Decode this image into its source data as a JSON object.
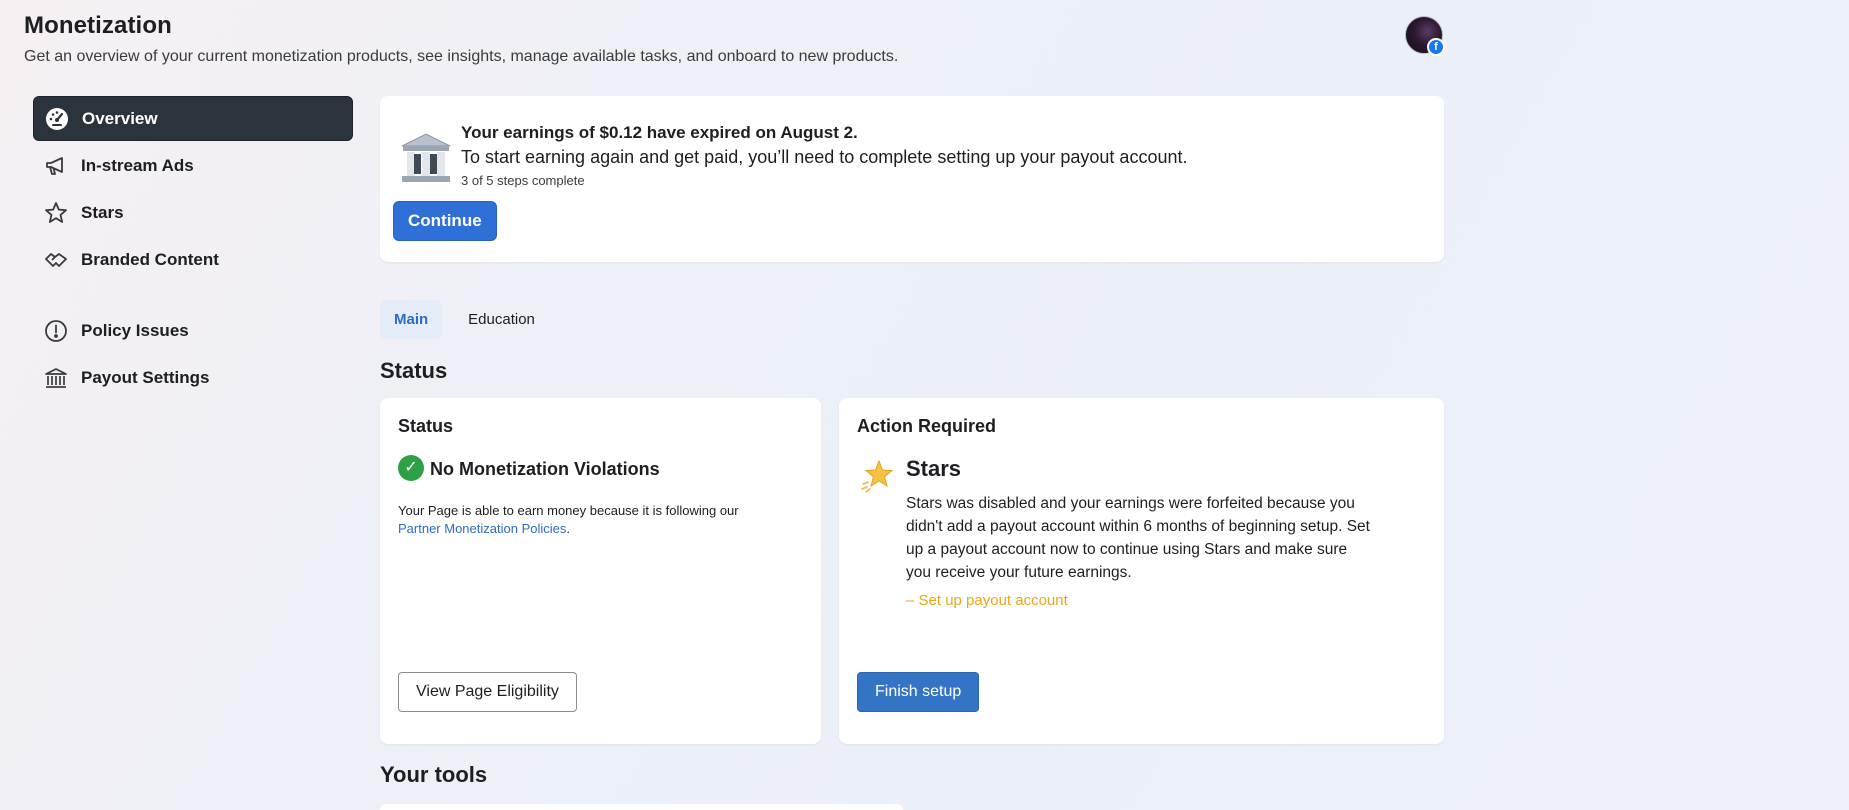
{
  "header": {
    "title": "Monetization",
    "subtitle": "Get an overview of your current monetization products, see insights, manage available tasks, and onboard to new products."
  },
  "sidebar": {
    "items": [
      {
        "label": "Overview",
        "icon": "dashboard-gauge-icon"
      },
      {
        "label": "In-stream Ads",
        "icon": "megaphone-icon"
      },
      {
        "label": "Stars",
        "icon": "star-outline-icon"
      },
      {
        "label": "Branded Content",
        "icon": "handshake-icon"
      },
      {
        "label": "Policy Issues",
        "icon": "alert-circle-icon"
      },
      {
        "label": "Payout Settings",
        "icon": "bank-icon"
      }
    ]
  },
  "payout_banner": {
    "title": "Your earnings of $0.12 have expired on August 2.",
    "text": "To start earning again and get paid, you’ll need to complete setting up your payout account.",
    "steps": "3 of 5 steps complete",
    "button": "Continue"
  },
  "tabs": [
    {
      "label": "Main",
      "active": true
    },
    {
      "label": "Education",
      "active": false
    }
  ],
  "sections": {
    "status": "Status",
    "tools": "Your tools"
  },
  "status_card": {
    "heading": "Status",
    "main": "No Monetization Violations",
    "desc": "Your Page is able to earn money because it is following our ",
    "link": "Partner Monetization Policies",
    "desc_end": ".",
    "button": "View Page Eligibility"
  },
  "action_card": {
    "heading": "Action Required",
    "title": "Stars",
    "desc": "Stars was disabled and your earnings were forfeited because you didn't add a payout account within 6 months of beginning setup. Set up a payout account now to continue using Stars and make sure you receive your future earnings.",
    "task": "– Set up payout account",
    "button": "Finish setup"
  },
  "colors": {
    "accent": "#2f6fd8",
    "success": "#2ea045",
    "warning": "#e6a817",
    "sidebar_active": "#2b333c"
  }
}
